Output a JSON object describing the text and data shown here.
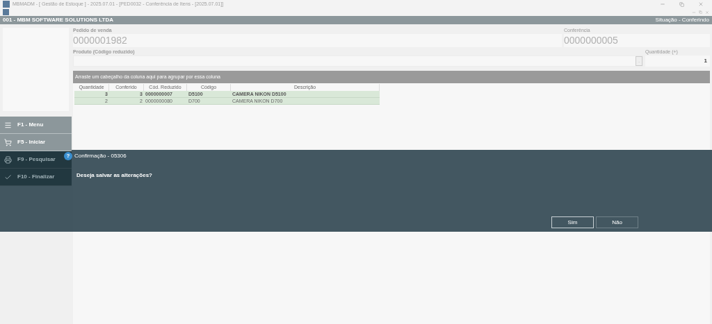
{
  "window": {
    "title": "MBMADM - [ Gestão de Estoque ] - 2025.07.01 - [PED0032 - Conferência de Itens - [2025.07.01]]"
  },
  "header": {
    "company": "001 - MBM SOFTWARE SOLUTIONS LTDA",
    "status": "Situação - Conferindo"
  },
  "fields": {
    "pedido_label": "Pedido de venda",
    "pedido_value": "0000001982",
    "conferencia_label": "Conferência",
    "conferencia_value": "0000000005",
    "produto_label": "Produto (Código reduzido)",
    "produto_button": ".",
    "quantidade_label": "Quantidade (+)",
    "quantidade_value": "1"
  },
  "sidebar": {
    "items": [
      {
        "label": "F1 - Menu"
      },
      {
        "label": "F5 - Iniciar"
      },
      {
        "label": "F9 - Pesquisar"
      },
      {
        "label": "F10 - Finalizar"
      }
    ]
  },
  "grid": {
    "group_hint": "Arraste um cabeçalho da coluna aqui para agrupar por essa coluna",
    "columns": [
      "Quantidade",
      "Conferido",
      "Cód. Reduzido",
      "Código",
      "Descrição"
    ],
    "rows": [
      {
        "selected": true,
        "cells": [
          "3",
          "3",
          "0000000007",
          "D5100",
          "CAMERA NIKON D5100"
        ]
      },
      {
        "selected": false,
        "cells": [
          "2",
          "2",
          "0000000080",
          "D700",
          "CAMERA NIKON D700"
        ]
      }
    ]
  },
  "dialog": {
    "icon": "?",
    "title": "Confirmação - 05306",
    "message": "Deseja salvar as alterações?",
    "buttons": [
      {
        "label": "Sim",
        "selected": true
      },
      {
        "label": "Não",
        "selected": false
      }
    ]
  }
}
